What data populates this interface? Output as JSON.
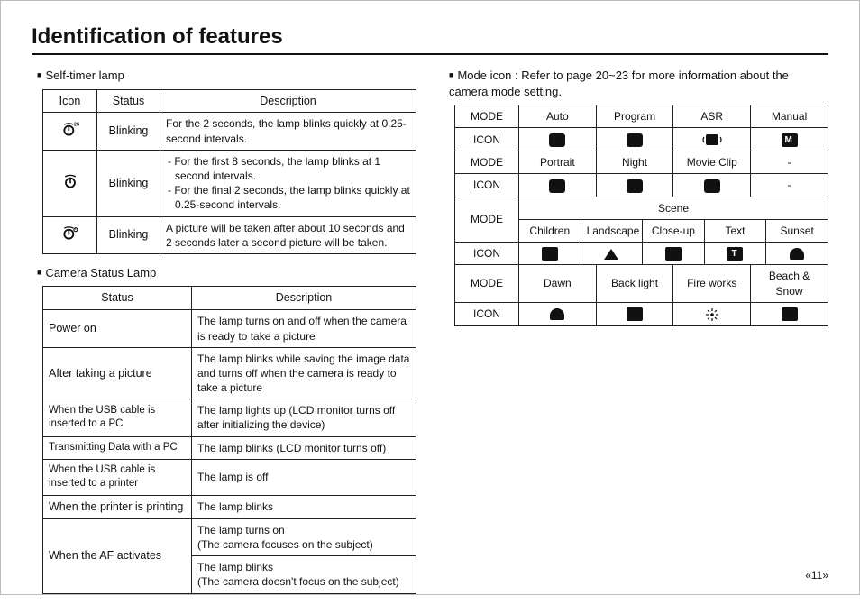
{
  "page_title": "Identification of features",
  "page_number": "«11»",
  "left": {
    "selftimer_heading": "Self-timer lamp",
    "selftimer_headers": {
      "icon": "Icon",
      "status": "Status",
      "desc": "Description"
    },
    "selftimer_rows": [
      {
        "status": "Blinking",
        "desc": "For the 2 seconds, the lamp blinks quickly at 0.25-second intervals."
      },
      {
        "status": "Blinking",
        "desc1": "- For the first 8 seconds, the lamp blinks at 1 second intervals.",
        "desc2": "- For the final 2 seconds, the lamp blinks quickly at 0.25-second intervals."
      },
      {
        "status": "Blinking",
        "desc": "A picture will be taken after about 10 seconds and 2 seconds later a second picture will be taken."
      }
    ],
    "camstatus_heading": "Camera Status Lamp",
    "camstatus_headers": {
      "status": "Status",
      "desc": "Description"
    },
    "camstatus_rows": [
      {
        "status": "Power on",
        "desc": "The lamp turns on and off when the camera is ready to take a picture"
      },
      {
        "status": "After taking a picture",
        "desc": "The lamp blinks while saving the image data and turns off when the camera is ready to take a picture"
      },
      {
        "status": "When the USB cable is inserted to a PC",
        "desc": "The lamp lights up (LCD monitor turns off after initializing the device)"
      },
      {
        "status": "Transmitting Data with a PC",
        "desc": "The lamp blinks (LCD monitor turns off)"
      },
      {
        "status": "When the USB cable is inserted to a printer",
        "desc": "The lamp is off"
      },
      {
        "status": "When the printer is printing",
        "desc": "The lamp blinks"
      },
      {
        "status": "When the AF activates",
        "desc1": "The lamp turns on",
        "desc1b": "(The camera focuses on the subject)",
        "desc2": "The lamp blinks",
        "desc2b": "(The camera doesn't focus on the subject)"
      }
    ]
  },
  "right": {
    "heading": "Mode icon : Refer to page 20~23 for more information about the camera mode setting.",
    "labels": {
      "mode": "MODE",
      "icon": "ICON",
      "scene": "Scene",
      "dash": "-"
    },
    "row1": [
      "Auto",
      "Program",
      "ASR",
      "Manual"
    ],
    "row3": [
      "Portrait",
      "Night",
      "Movie Clip"
    ],
    "scene_row1": [
      "Children",
      "Landscape",
      "Close-up",
      "Text",
      "Sunset"
    ],
    "scene_row2": [
      "Dawn",
      "Back light",
      "Fire works",
      "Beach & Snow"
    ]
  }
}
